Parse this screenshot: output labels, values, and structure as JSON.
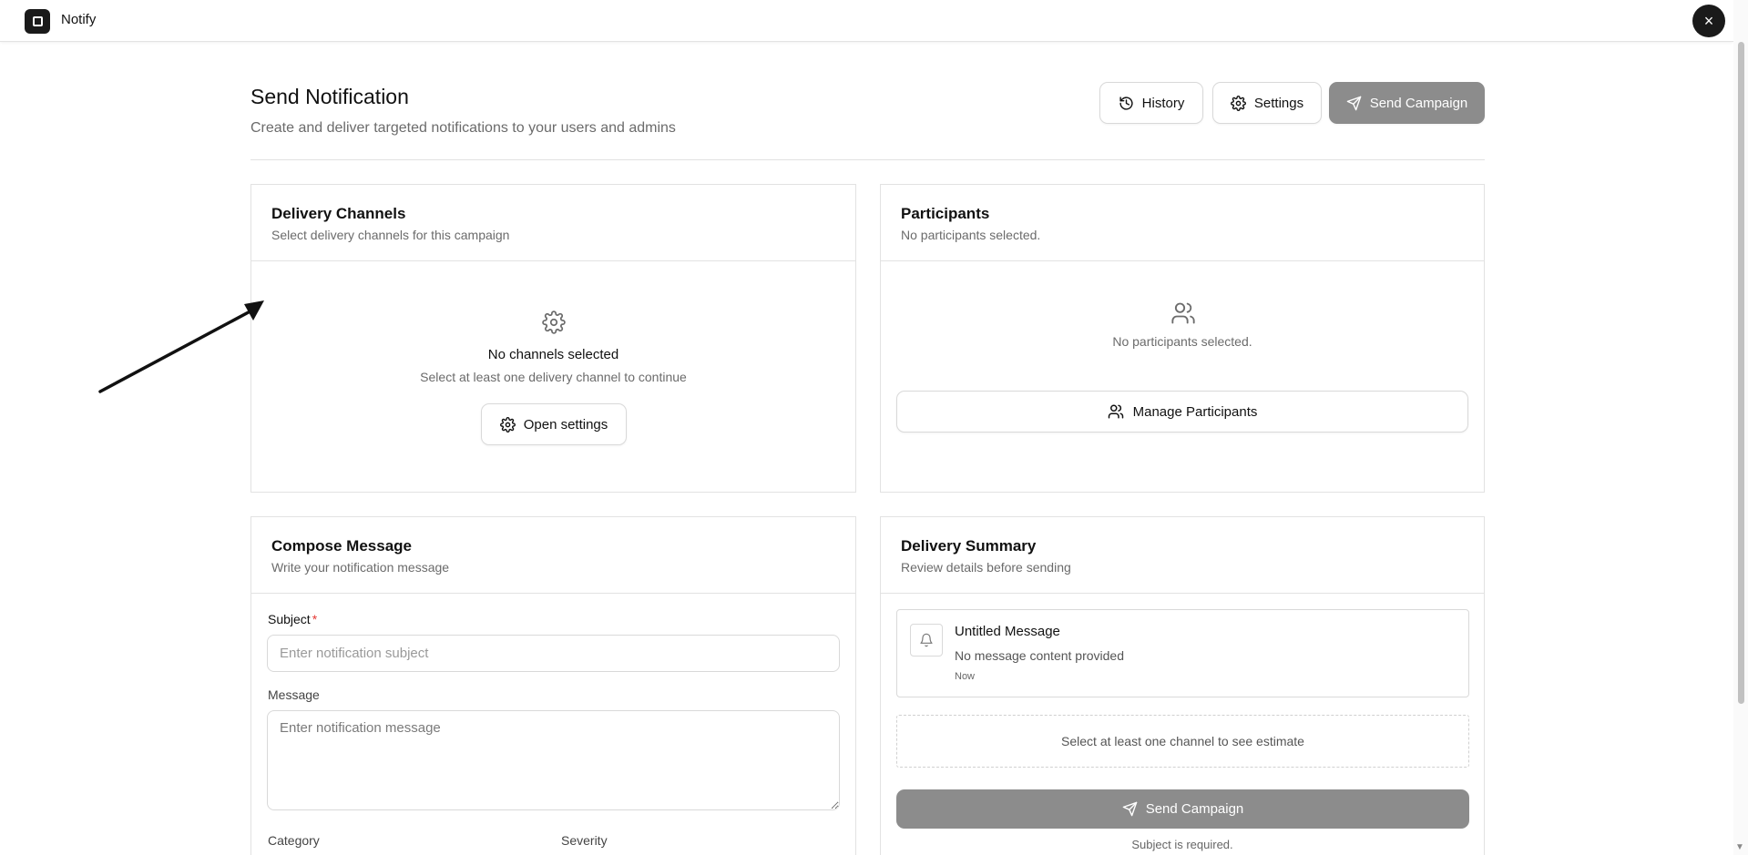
{
  "app": {
    "title": "Notify",
    "close_label": "×"
  },
  "header": {
    "title": "Send Notification",
    "subtitle": "Create and deliver targeted notifications to your users and admins",
    "history_label": "History",
    "settings_label": "Settings",
    "send_label": "Send Campaign"
  },
  "delivery": {
    "title": "Delivery Channels",
    "subtitle": "Select delivery channels for this campaign",
    "empty_title": "No channels selected",
    "empty_sub": "Select at least one delivery channel to continue",
    "open_settings_label": "Open settings"
  },
  "participants": {
    "title": "Participants",
    "subtitle": "No participants selected.",
    "empty_text": "No participants selected.",
    "manage_label": "Manage Participants"
  },
  "compose": {
    "title": "Compose Message",
    "subtitle": "Write your notification message",
    "subject_label": "Subject",
    "subject_required": "*",
    "subject_placeholder": "Enter notification subject",
    "subject_value": "",
    "message_label": "Message",
    "message_placeholder": "Enter notification message",
    "message_value": "",
    "category_label": "Category",
    "severity_label": "Severity"
  },
  "summary": {
    "title": "Delivery Summary",
    "subtitle": "Review details before sending",
    "preview_title": "Untitled Message",
    "preview_body": "No message content provided",
    "preview_time": "Now",
    "estimate_text": "Select at least one channel to see estimate",
    "send_label": "Send Campaign",
    "requirement_note": "Subject is required."
  },
  "colors": {
    "disabled_button": "#8c8c8c",
    "required_mark": "#e53935",
    "border": "#e2e2e2"
  }
}
